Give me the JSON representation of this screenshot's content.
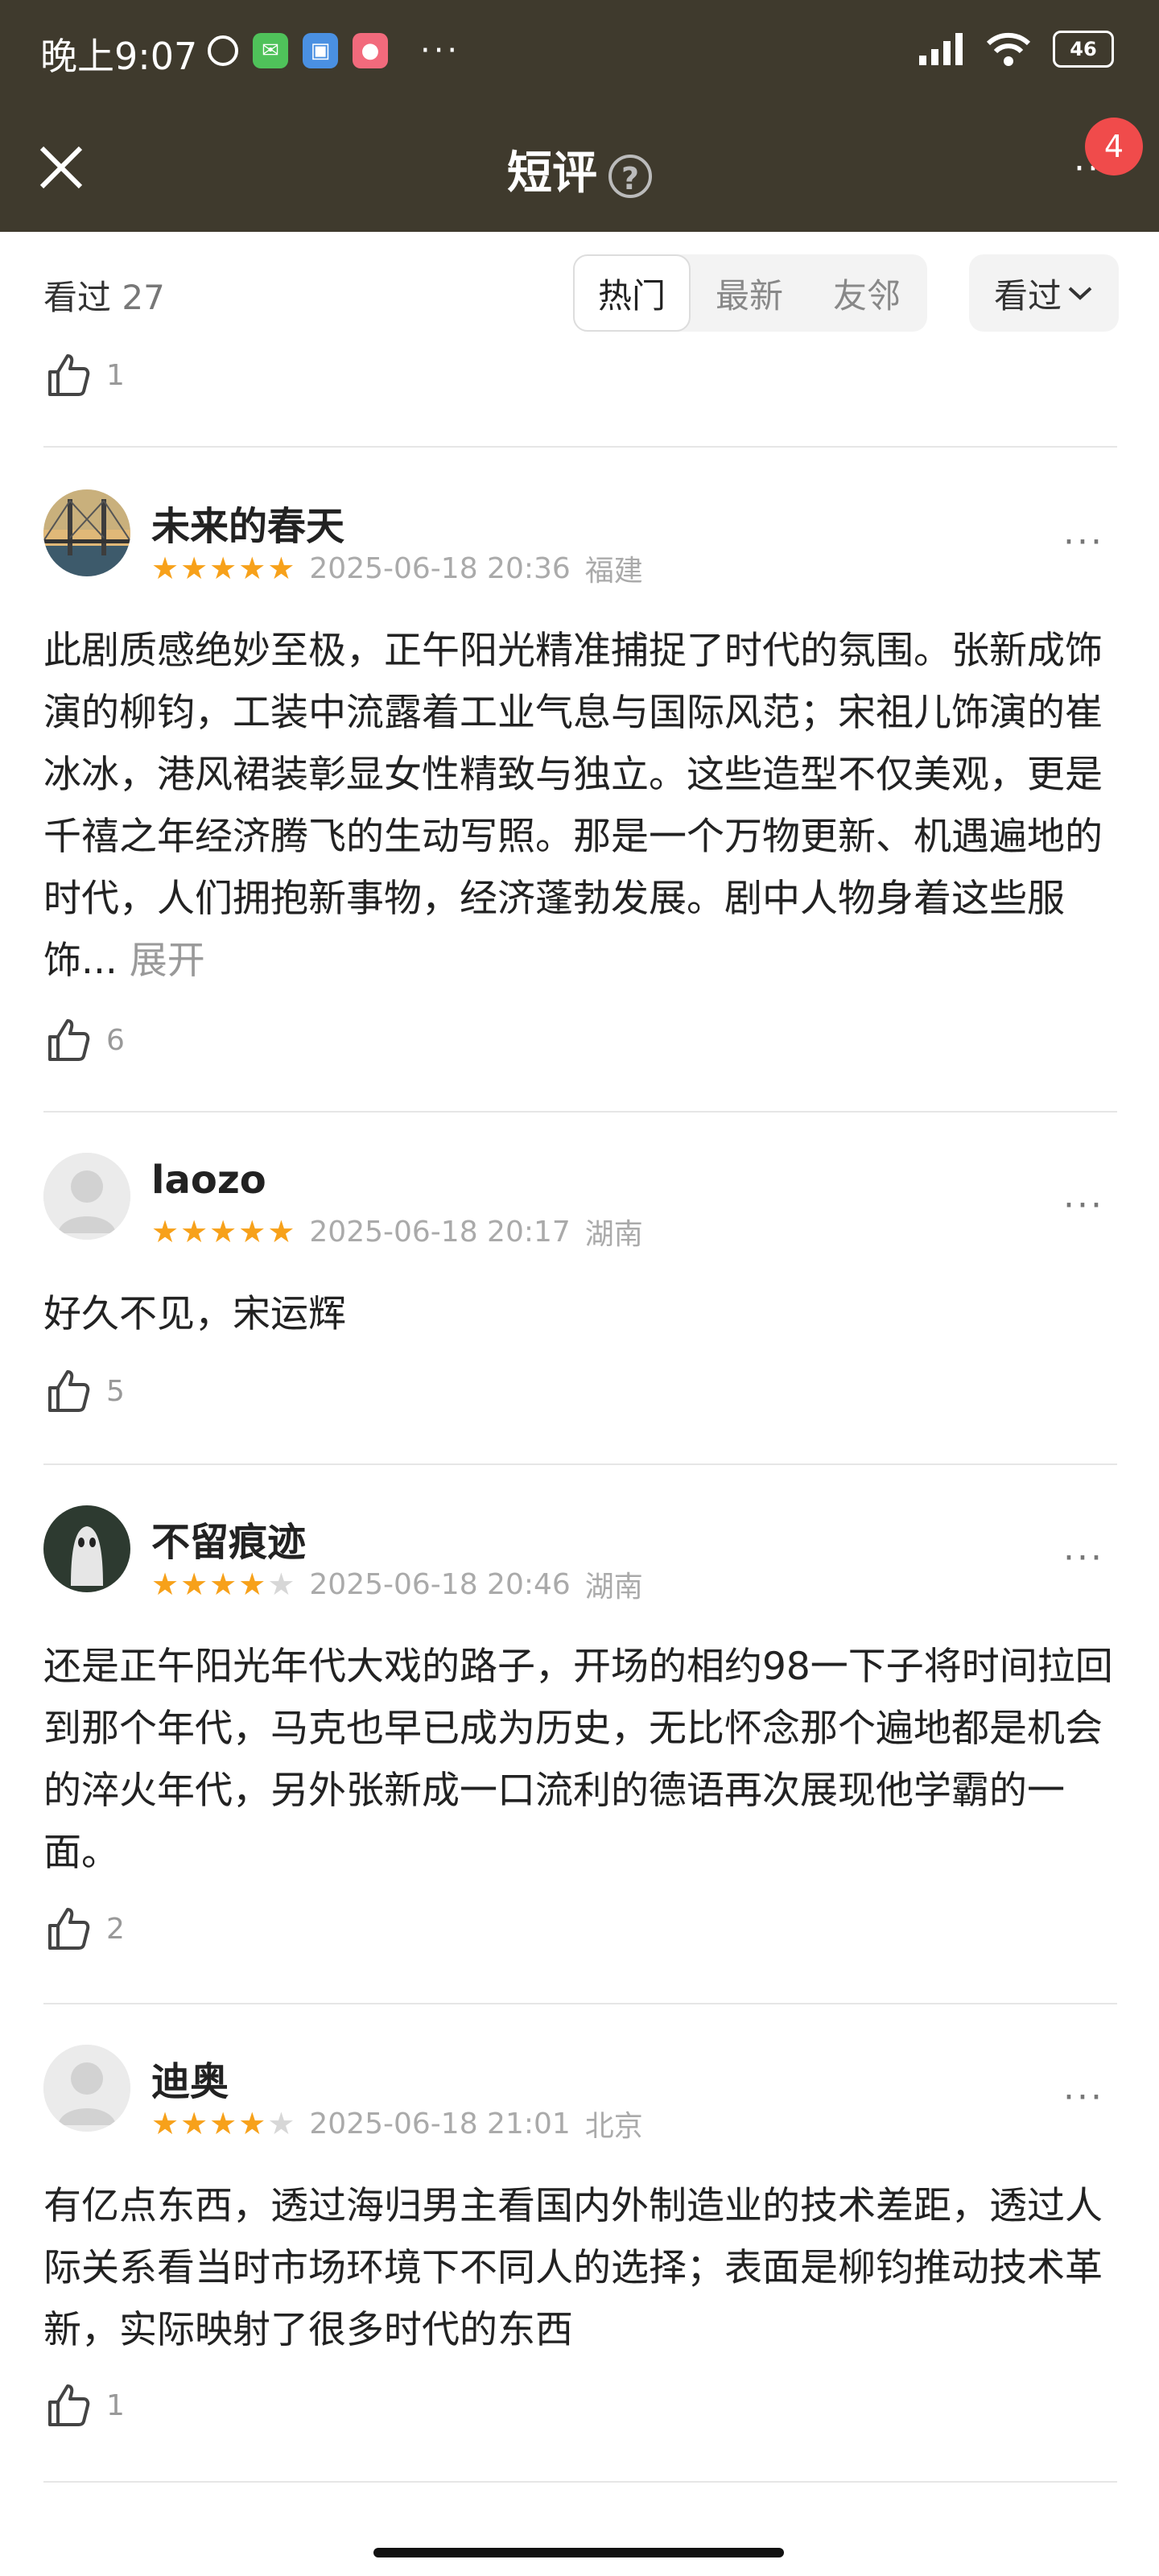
{
  "status": {
    "time": "晚上9:07",
    "battery": "46"
  },
  "header": {
    "title": "短评",
    "help_icon": "?",
    "notification_count": "4"
  },
  "filter": {
    "label": "看过",
    "count": "27",
    "tabs": [
      "热门",
      "最新",
      "友邻"
    ],
    "active_tab": "热门",
    "dropdown_label": "看过"
  },
  "previous_likes": "1",
  "comments": [
    {
      "name": "未来的春天",
      "rating": 5,
      "date": "2025-06-18 20:36",
      "location": "福建",
      "text": "此剧质感绝妙至极，正午阳光精准捕捉了时代的氛围。张新成饰演的柳钧，工装中流露着工业气息与国际风范；宋祖儿饰演的崔冰冰，港风裙装彰显女性精致与独立。这些造型不仅美观，更是千禧之年经济腾飞的生动写照。那是一个万物更新、机遇遍地的时代，人们拥抱新事物，经济蓬勃发展。剧中人物身着这些服饰...",
      "expand": "展开",
      "likes": "6"
    },
    {
      "name": "laozo",
      "rating": 5,
      "date": "2025-06-18 20:17",
      "location": "湖南",
      "text": "好久不见，宋运辉",
      "likes": "5"
    },
    {
      "name": "不留痕迹",
      "rating": 4,
      "date": "2025-06-18 20:46",
      "location": "湖南",
      "text": "还是正午阳光年代大戏的路子，开场的相约98一下子将时间拉回到那个年代，马克也早已成为历史，无比怀念那个遍地都是机会的淬火年代，另外张新成一口流利的德语再次展现他学霸的一面。",
      "likes": "2"
    },
    {
      "name": "迪奥",
      "rating": 4,
      "date": "2025-06-18 21:01",
      "location": "北京",
      "text": "有亿点东西，透过海归男主看国内外制造业的技术差距，透过人际关系看当时市场环境下不同人的选择；表面是柳钧推动技术革新，实际映射了很多时代的东西",
      "likes": "1"
    }
  ],
  "colors": {
    "header_bg": "#3f3a2d",
    "star": "#f7a11a",
    "badge": "#f04b4b"
  }
}
